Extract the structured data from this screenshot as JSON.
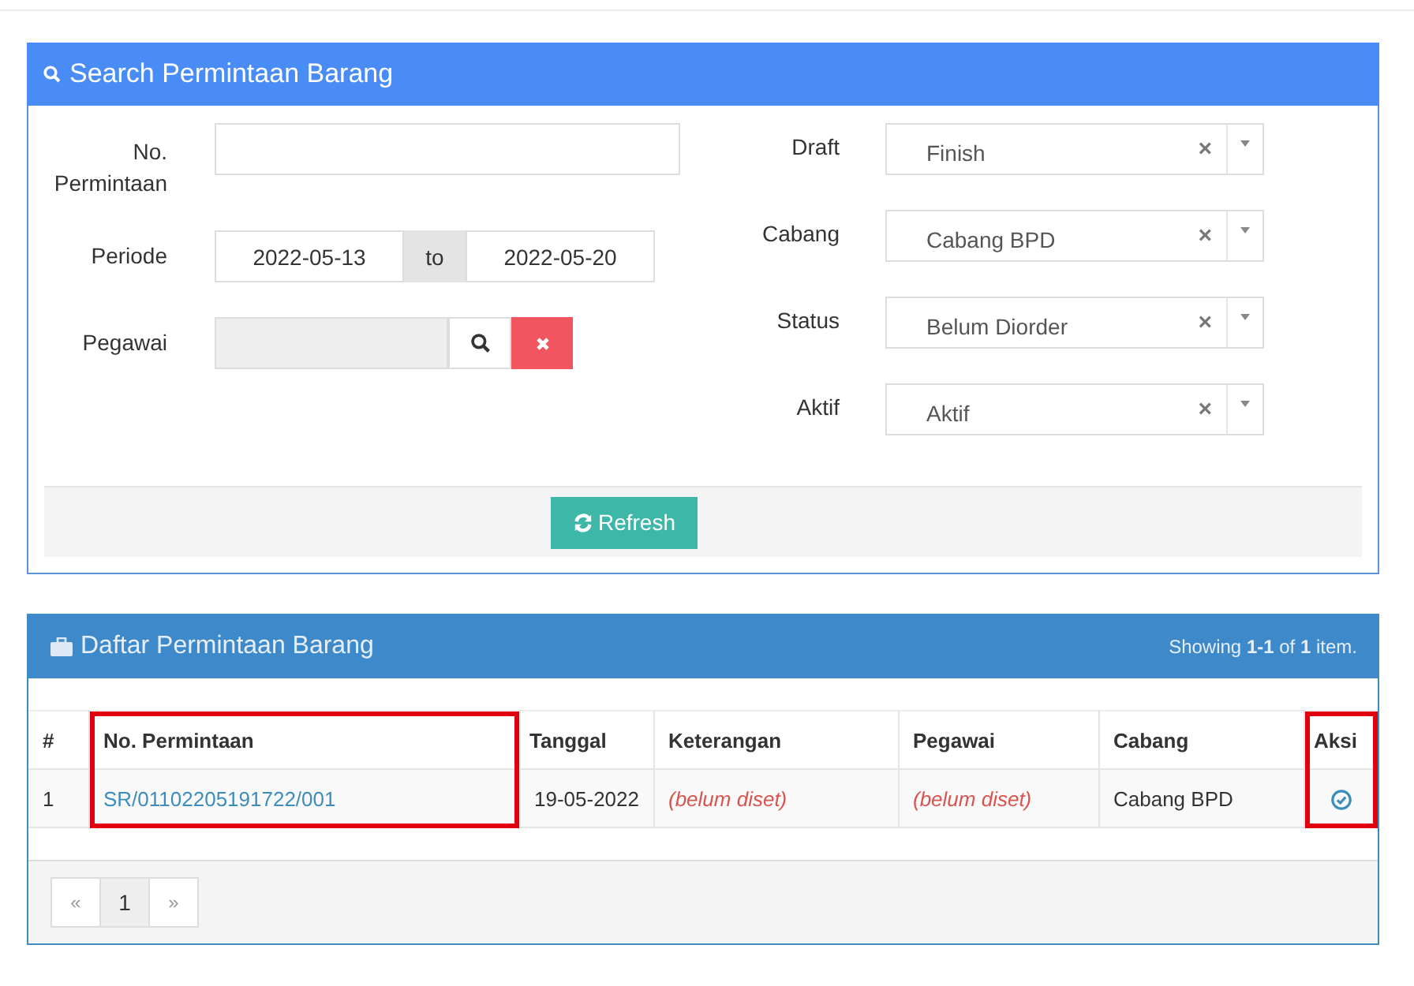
{
  "search_panel": {
    "title": "Search Permintaan Barang",
    "left_fields": [
      {
        "kind": "text",
        "label": "No. Permintaan"
      },
      {
        "kind": "daterange",
        "label": "Periode",
        "from": "2022-05-13",
        "separator": "to",
        "to": "2022-05-20"
      },
      {
        "kind": "lookup",
        "label": "Pegawai"
      }
    ],
    "right_fields": [
      {
        "label": "Draft",
        "value": "Finish",
        "clear": "×"
      },
      {
        "label": "Cabang",
        "value": "Cabang BPD",
        "clear": "×"
      },
      {
        "label": "Status",
        "value": "Belum Diorder",
        "clear": "×"
      },
      {
        "label": "Aktif",
        "value": "Aktif",
        "clear": "×"
      }
    ],
    "refresh_button": "Refresh"
  },
  "list_panel": {
    "title": "Daftar Permintaan Barang",
    "summary": "Showing **1-1** of **1** item.",
    "columns": [
      {
        "label": "#",
        "highlighted": false
      },
      {
        "label": "No. Permintaan",
        "highlighted": true
      },
      {
        "label": "Tanggal",
        "highlighted": false
      },
      {
        "label": "Keterangan",
        "highlighted": false
      },
      {
        "label": "Pegawai",
        "highlighted": false
      },
      {
        "label": "Cabang",
        "highlighted": false
      },
      {
        "label": "Aksi",
        "highlighted": true
      }
    ],
    "rows": [
      {
        "cells": [
          {
            "kind": "plain",
            "text": "1"
          },
          {
            "kind": "link",
            "text": "SR/01102205191722/001"
          },
          {
            "kind": "plain",
            "text": "19-05-2022"
          },
          {
            "kind": "unset",
            "text": "(belum diset)"
          },
          {
            "kind": "unset",
            "text": "(belum diset)"
          },
          {
            "kind": "plain",
            "text": "Cabang BPD"
          },
          {
            "kind": "action"
          }
        ]
      }
    ],
    "pagination": {
      "prev": "«",
      "pages": [
        {
          "label": "1",
          "selected": true
        }
      ],
      "next": "»"
    }
  }
}
